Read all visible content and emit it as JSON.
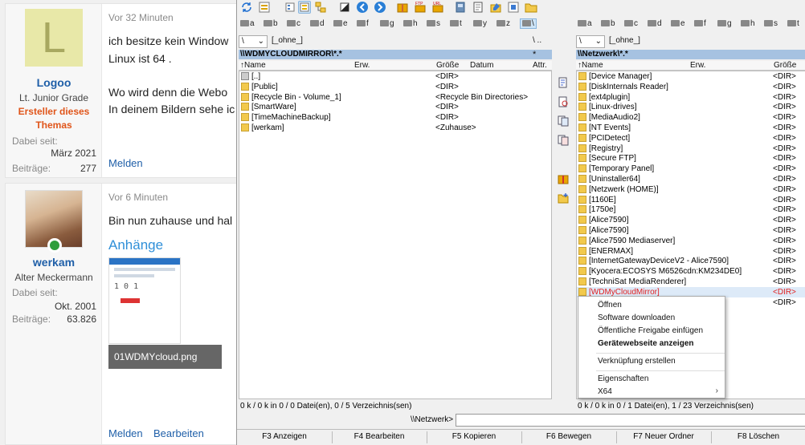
{
  "post1": {
    "avatar_letter": "L",
    "username": "Logoo",
    "rank": "Lt. Junior Grade",
    "starter": "Ersteller dieses Themas",
    "joined_label": "Dabei seit:",
    "joined_value": "März 2021",
    "posts_label": "Beiträge:",
    "posts_value": "277",
    "time": "Vor 32 Minuten",
    "line1": "ich besitze kein Window",
    "line2": "Linux ist 64 .",
    "line3": "Wo wird denn die Webo",
    "line4": "In deinem Bildern sehe ic",
    "report": "Melden"
  },
  "post2": {
    "username": "werkam",
    "rank": "Alter Meckermann",
    "joined_label": "Dabei seit:",
    "joined_value": "Okt. 2001",
    "posts_label": "Beiträge:",
    "posts_value": "63.826",
    "time": "Vor 6 Minuten",
    "line1": "Bin nun zuhause und hal",
    "attachments": "Anhänge",
    "thumb_num": "1 0 1",
    "attachment_name": "01WDMYcloud.png",
    "report": "Melden",
    "edit": "Bearbeiten"
  },
  "tc": {
    "left_drives": [
      "a",
      "b",
      "c",
      "d",
      "e",
      "f",
      "g",
      "h",
      "s",
      "t",
      "y",
      "z",
      "\\"
    ],
    "right_drives": [
      "a",
      "b",
      "c",
      "d",
      "e",
      "f",
      "g",
      "h",
      "s",
      "t"
    ],
    "left_combo": "\\",
    "left_label": "[_ohne_]",
    "left_dotslabel": "\\ ..",
    "left_star": "*",
    "left_path": "\\\\WDMYCLOUDMIRROR\\*.*",
    "right_combo": "\\",
    "right_label": "[_ohne_]",
    "right_path": "\\\\Netzwerk\\*.*",
    "left_headers": {
      "name": "↑Name",
      "ext": "Erw.",
      "size": "Größe",
      "date": "Datum",
      "attr": "Attr."
    },
    "right_headers": {
      "name": "↑Name",
      "ext": "Erw.",
      "size": "Größe"
    },
    "left_rows": [
      {
        "name": "[..]",
        "size": "<DIR>",
        "icon": "up"
      },
      {
        "name": "[Public]",
        "size": "<DIR>",
        "icon": "folder"
      },
      {
        "name": "[Recycle Bin - Volume_1]",
        "size": "<Recycle Bin Directories>",
        "icon": "folder"
      },
      {
        "name": "[SmartWare]",
        "size": "<DIR>",
        "icon": "folder"
      },
      {
        "name": "[TimeMachineBackup]",
        "size": "<DIR>",
        "icon": "folder"
      },
      {
        "name": "[werkam]",
        "size": "<Zuhause>",
        "icon": "folder"
      }
    ],
    "right_rows": [
      {
        "name": "[Device Manager]",
        "size": "<DIR>"
      },
      {
        "name": "[DiskInternals Reader]",
        "size": "<DIR>"
      },
      {
        "name": "[ext4plugin]",
        "size": "<DIR>"
      },
      {
        "name": "[Linux-drives]",
        "size": "<DIR>"
      },
      {
        "name": "[MediaAudio2]",
        "size": "<DIR>"
      },
      {
        "name": "[NT Events]",
        "size": "<DIR>"
      },
      {
        "name": "[PCIDetect]",
        "size": "<DIR>"
      },
      {
        "name": "[Registry]",
        "size": "<DIR>"
      },
      {
        "name": "[Secure FTP]",
        "size": "<DIR>"
      },
      {
        "name": "[Temporary Panel]",
        "size": "<DIR>"
      },
      {
        "name": "[Uninstaller64]",
        "size": "<DIR>"
      },
      {
        "name": "[Netzwerk (HOME)]",
        "size": "<DIR>"
      },
      {
        "name": "[1160E]",
        "size": "<DIR>"
      },
      {
        "name": "[1750e]",
        "size": "<DIR>"
      },
      {
        "name": "[Alice7590]",
        "size": "<DIR>"
      },
      {
        "name": "[Alice7590]",
        "size": "<DIR>"
      },
      {
        "name": "[Alice7590 Mediaserver]",
        "size": "<DIR>"
      },
      {
        "name": "[ENERMAX]",
        "size": "<DIR>"
      },
      {
        "name": "[InternetGatewayDeviceV2 - Alice7590]",
        "size": "<DIR>"
      },
      {
        "name": "[Kyocera:ECOSYS M6526cdn:KM234DE0]",
        "size": "<DIR>"
      },
      {
        "name": "[TechniSat MediaRenderer]",
        "size": "<DIR>"
      },
      {
        "name": "[WDMyCloudMirror]",
        "size": "<DIR>",
        "selected": true
      },
      {
        "name": "",
        "size": "<DIR>"
      }
    ],
    "left_status": "0 k / 0 k in 0 / 0 Datei(en), 0 / 5 Verzeichnis(sen)",
    "right_status": "0 k / 0 k in 0 / 1 Datei(en), 1 / 23 Verzeichnis(sen)",
    "cmd_label": "\\\\Netzwerk>",
    "fkeys": [
      "F3 Anzeigen",
      "F4 Bearbeiten",
      "F5 Kopieren",
      "F6 Bewegen",
      "F7 Neuer Ordner",
      "F8 Löschen"
    ],
    "context_menu": {
      "open": "Öffnen",
      "download": "Software downloaden",
      "share": "Öffentliche Freigabe einfügen",
      "device_page": "Gerätewebseite anzeigen",
      "shortcut": "Verknüpfung erstellen",
      "properties": "Eigenschaften",
      "x64": "X64",
      "arrow": "›"
    }
  }
}
